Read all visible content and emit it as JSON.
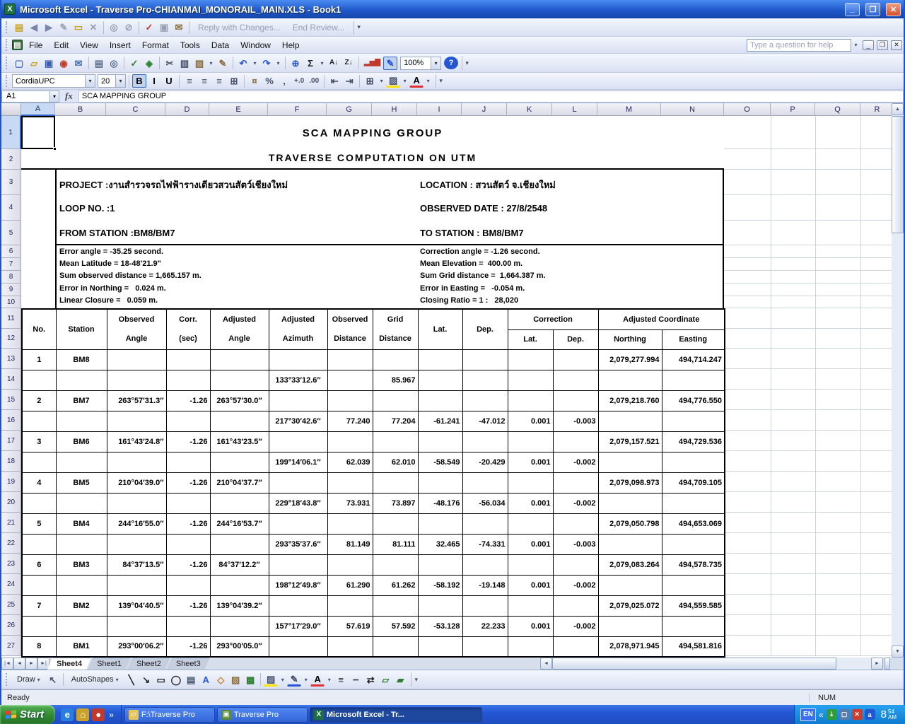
{
  "window": {
    "title": "Microsoft Excel - Traverse Pro-CHIANMAI_MONORAIL_MAIN.XLS - Book1"
  },
  "review_toolbar": {
    "items": [
      {
        "name": "new-comment",
        "g": "▤",
        "c": "#c9a227"
      },
      {
        "name": "previous-comment",
        "g": "◀",
        "c": "#7a86a8"
      },
      {
        "name": "next-comment",
        "g": "▶",
        "c": "#7a86a8"
      },
      {
        "name": "edit-comment",
        "g": "✎",
        "c": "#9aa0b5"
      },
      {
        "name": "show-comments",
        "g": "▭",
        "c": "#c9a227"
      },
      {
        "name": "delete-comment",
        "g": "✕",
        "c": "#9aa0b5",
        "sepAfter": true
      },
      {
        "name": "accept-change",
        "g": "◎",
        "c": "#9aa0b5"
      },
      {
        "name": "reject-change",
        "g": "⊘",
        "c": "#9aa0b5",
        "sepAfter": true
      },
      {
        "name": "update-file",
        "g": "✓",
        "c": "#c03a2b"
      },
      {
        "name": "save-version",
        "g": "▣",
        "c": "#9aa0b5"
      },
      {
        "name": "mail-recipient",
        "g": "✉",
        "c": "#8a6d3b",
        "sepAfter": true
      }
    ],
    "reply_label": "Reply with Changes...",
    "end_label": "End Review..."
  },
  "menus": [
    "File",
    "Edit",
    "View",
    "Insert",
    "Format",
    "Tools",
    "Data",
    "Window",
    "Help"
  ],
  "help_box_placeholder": "Type a question for help",
  "standard_toolbar": {
    "items": [
      {
        "name": "new-workbook",
        "g": "▢",
        "c": "#4a6fb5"
      },
      {
        "name": "open",
        "g": "▱",
        "c": "#c9a227"
      },
      {
        "name": "save",
        "g": "▣",
        "c": "#3a5fae"
      },
      {
        "name": "permission",
        "g": "◉",
        "c": "#c03a2b"
      },
      {
        "name": "email",
        "g": "✉",
        "c": "#4a6fb5",
        "sepAfter": true
      },
      {
        "name": "print",
        "g": "▤",
        "c": "#5a6e8c"
      },
      {
        "name": "print-preview",
        "g": "◎",
        "c": "#5a6e8c",
        "sepAfter": true
      },
      {
        "name": "spelling",
        "g": "✓",
        "c": "#2e7d32"
      },
      {
        "name": "research",
        "g": "◈",
        "c": "#2e7d32",
        "sepAfter": true
      },
      {
        "name": "cut",
        "g": "✂",
        "c": "#44506b"
      },
      {
        "name": "copy",
        "g": "▥",
        "c": "#44506b"
      },
      {
        "name": "paste",
        "g": "▧",
        "c": "#8a6d3b",
        "dd": true
      },
      {
        "name": "format-painter",
        "g": "✎",
        "c": "#8a6d3b",
        "sepAfter": true
      },
      {
        "name": "undo",
        "g": "↶",
        "c": "#2456d4",
        "dd": true
      },
      {
        "name": "redo",
        "g": "↷",
        "c": "#2456d4",
        "dd": true,
        "sepAfter": true
      },
      {
        "name": "insert-hyperlink",
        "g": "⊕",
        "c": "#2456d4"
      },
      {
        "name": "autosum",
        "g": "Σ",
        "c": "#222222",
        "dd": true
      },
      {
        "name": "sort-ascending",
        "g": "A↓",
        "c": "#222222",
        "small": true
      },
      {
        "name": "sort-descending",
        "g": "Z↓",
        "c": "#222222",
        "small": true,
        "sepAfter": true
      },
      {
        "name": "chart-wizard",
        "g": "▂▅▇",
        "c": "#c03a2b",
        "small": true
      },
      {
        "name": "drawing",
        "g": "✎",
        "c": "#2456d4",
        "active": true
      }
    ],
    "zoom_value": "100%",
    "help_glyph": "?"
  },
  "formatting_toolbar": {
    "font_name": "CordiaUPC",
    "font_size": "20",
    "items": [
      {
        "name": "bold",
        "g": "B",
        "c": "#000000",
        "active": true
      },
      {
        "name": "italic",
        "g": "I",
        "c": "#000000"
      },
      {
        "name": "underline",
        "g": "U",
        "c": "#000000",
        "sepAfter": true
      },
      {
        "name": "align-left",
        "g": "≡",
        "c": "#44506b"
      },
      {
        "name": "align-center",
        "g": "≡",
        "c": "#44506b"
      },
      {
        "name": "align-right",
        "g": "≡",
        "c": "#44506b"
      },
      {
        "name": "merge-center",
        "g": "⊞",
        "c": "#44506b",
        "sepAfter": true
      },
      {
        "name": "currency",
        "g": "¤",
        "c": "#8a6d3b"
      },
      {
        "name": "percent",
        "g": "%",
        "c": "#44506b"
      },
      {
        "name": "comma",
        "g": ",",
        "c": "#44506b"
      },
      {
        "name": "increase-decimal",
        "g": "+.0",
        "c": "#44506b",
        "small": true
      },
      {
        "name": "decrease-decimal",
        "g": ".00",
        "c": "#44506b",
        "small": true,
        "sepAfter": true
      },
      {
        "name": "decrease-indent",
        "g": "⇤",
        "c": "#44506b"
      },
      {
        "name": "increase-indent",
        "g": "⇥",
        "c": "#44506b",
        "sepAfter": true
      },
      {
        "name": "borders",
        "g": "⊞",
        "c": "#44506b",
        "dd": true
      },
      {
        "name": "fill-color",
        "g": "▨",
        "c": "#44506b",
        "u": "#ffe400",
        "dd": true
      },
      {
        "name": "font-color",
        "g": "A",
        "c": "#000000",
        "u": "#e03030",
        "dd": true
      }
    ]
  },
  "formula_bar": {
    "name_box": "A1",
    "fx": "fx",
    "formula": "SCA MAPPING GROUP"
  },
  "sheet": {
    "columns": [
      "A",
      "B",
      "C",
      "D",
      "E",
      "F",
      "G",
      "H",
      "I",
      "J",
      "K",
      "L",
      "M",
      "N",
      "O",
      "P",
      "Q",
      "R"
    ],
    "rows": [
      "1",
      "2",
      "3",
      "4",
      "5",
      "6",
      "7",
      "8",
      "9",
      "10",
      "11",
      "12",
      "13",
      "14",
      "15",
      "16",
      "17",
      "18",
      "19",
      "20",
      "21",
      "22",
      "23",
      "24",
      "25",
      "26",
      "27"
    ],
    "titles": [
      "SCA MAPPING GROUP",
      "TRAVERSE COMPUTATION ON UTM"
    ],
    "info": {
      "left": [
        "PROJECT :งานสำรวจรถไฟฟ้ารางเดียวสวนสัตว์เชียงใหม่",
        "LOOP NO. :1",
        "FROM STATION :BM8/BM7"
      ],
      "right": [
        "LOCATION : สวนสัตว์ จ.เชียงใหม่",
        "OBSERVED DATE : 27/8/2548",
        "TO STATION : BM8/BM7"
      ]
    },
    "stats": {
      "left": [
        "Error angle = -35.25 second.",
        "Mean Latitude = 18-48'21.9\"",
        "Sum observed distance = 1,665.157 m.",
        "Error in Northing =   0.024 m.",
        "Linear Closure =   0.059 m."
      ],
      "right": [
        "Correction angle = -1.26 second.",
        "Mean Elevation =  400.00 m.",
        "Sum Grid distance =  1,664.387 m.",
        "Error in Easting =   -0.054 m.",
        "Closing Ratio = 1 :   28,020"
      ]
    }
  },
  "grid": {
    "headers": {
      "no": "No.",
      "station": "Station",
      "observed": [
        "Observed",
        "Angle"
      ],
      "corr": [
        "Corr.",
        "(sec)"
      ],
      "adjusted": [
        "Adjusted",
        "Angle"
      ],
      "azimuth": [
        "Adjusted",
        "Azimuth"
      ],
      "obsdist": [
        "Observed",
        "Distance"
      ],
      "griddist": [
        "Grid",
        "Distance"
      ],
      "lat": "Lat.",
      "dep": "Dep.",
      "correction": "Correction",
      "corr_lat": "Lat.",
      "corr_dep": "Dep.",
      "adj_coord": "Adjusted Coordinate",
      "northing": "Northing",
      "easting": "Easting"
    },
    "rows": [
      {
        "no": "1",
        "st": "BM8",
        "n": "2,079,277.994",
        "e": "494,714.247"
      },
      {
        "az": "133°33′12.6″",
        "gd": "85.967"
      },
      {
        "no": "2",
        "st": "BM7",
        "oa": "263°57′31.3″",
        "c": "-1.26",
        "aa": "263°57′30.0″",
        "n": "2,079,218.760",
        "e": "494,776.550"
      },
      {
        "az": "217°30′42.6″",
        "od": "77.240",
        "gd": "77.204",
        "la": "-61.241",
        "de": "-47.012",
        "cl": "0.001",
        "cd": "-0.003"
      },
      {
        "no": "3",
        "st": "BM6",
        "oa": "161°43′24.8″",
        "c": "-1.26",
        "aa": "161°43′23.5″",
        "n": "2,079,157.521",
        "e": "494,729.536"
      },
      {
        "az": "199°14′06.1″",
        "od": "62.039",
        "gd": "62.010",
        "la": "-58.549",
        "de": "-20.429",
        "cl": "0.001",
        "cd": "-0.002"
      },
      {
        "no": "4",
        "st": "BM5",
        "oa": "210°04′39.0″",
        "c": "-1.26",
        "aa": "210°04′37.7″",
        "n": "2,079,098.973",
        "e": "494,709.105"
      },
      {
        "az": "229°18′43.8″",
        "od": "73.931",
        "gd": "73.897",
        "la": "-48.176",
        "de": "-56.034",
        "cl": "0.001",
        "cd": "-0.002"
      },
      {
        "no": "5",
        "st": "BM4",
        "oa": "244°16′55.0″",
        "c": "-1.26",
        "aa": "244°16′53.7″",
        "n": "2,079,050.798",
        "e": "494,653.069"
      },
      {
        "az": "293°35′37.6″",
        "od": "81.149",
        "gd": "81.111",
        "la": "32.465",
        "de": "-74.331",
        "cl": "0.001",
        "cd": "-0.003"
      },
      {
        "no": "6",
        "st": "BM3",
        "oa": "84°37′13.5″",
        "c": "-1.26",
        "aa": "84°37′12.2″",
        "n": "2,079,083.264",
        "e": "494,578.735"
      },
      {
        "az": "198°12′49.8″",
        "od": "61.290",
        "gd": "61.262",
        "la": "-58.192",
        "de": "-19.148",
        "cl": "0.001",
        "cd": "-0.002"
      },
      {
        "no": "7",
        "st": "BM2",
        "oa": "139°04′40.5″",
        "c": "-1.26",
        "aa": "139°04′39.2″",
        "n": "2,079,025.072",
        "e": "494,559.585"
      },
      {
        "az": "157°17′29.0″",
        "od": "57.619",
        "gd": "57.592",
        "la": "-53.128",
        "de": "22.233",
        "cl": "0.001",
        "cd": "-0.002"
      },
      {
        "no": "8",
        "st": "BM1",
        "oa": "293°00′06.2″",
        "c": "-1.26",
        "aa": "293°00′05.0″",
        "n": "2,078,971.945",
        "e": "494,581.816"
      }
    ]
  },
  "tabs": {
    "nav": [
      {
        "name": "first-sheet",
        "g": "|◄"
      },
      {
        "name": "previous-sheet",
        "g": "◄"
      },
      {
        "name": "next-sheet",
        "g": "►"
      },
      {
        "name": "last-sheet",
        "g": "►|"
      }
    ],
    "sheets": [
      {
        "label": "Sheet4",
        "active": true
      },
      {
        "label": "Sheet1"
      },
      {
        "label": "Sheet2"
      },
      {
        "label": "Sheet3"
      }
    ]
  },
  "drawing_toolbar": {
    "draw_label": "Draw",
    "autoshapes_label": "AutoShapes",
    "caret": "▾",
    "items": [
      {
        "name": "select-objects",
        "g": "↖",
        "c": "#44506b",
        "sepAfter": true
      },
      {
        "name": "line",
        "g": "╲",
        "c": "#222222"
      },
      {
        "name": "arrow",
        "g": "↘",
        "c": "#222222"
      },
      {
        "name": "rectangle",
        "g": "▭",
        "c": "#222222"
      },
      {
        "name": "oval",
        "g": "◯",
        "c": "#222222"
      },
      {
        "name": "text-box",
        "g": "▤",
        "c": "#44506b"
      },
      {
        "name": "wordart",
        "g": "A",
        "c": "#2456d4"
      },
      {
        "name": "insert-diagram",
        "g": "◇",
        "c": "#c9782a"
      },
      {
        "name": "clip-art",
        "g": "▨",
        "c": "#8a6d3b"
      },
      {
        "name": "insert-picture",
        "g": "▩",
        "c": "#2e7d32",
        "sepAfter": true
      },
      {
        "name": "fill-color",
        "g": "▨",
        "c": "#44506b",
        "u": "#ffe400",
        "dd": true
      },
      {
        "name": "line-color",
        "g": "✎",
        "c": "#44506b",
        "u": "#2456d4",
        "dd": true
      },
      {
        "name": "font-color",
        "g": "A",
        "c": "#000000",
        "u": "#e03030",
        "dd": true
      },
      {
        "name": "line-style",
        "g": "≡",
        "c": "#222222"
      },
      {
        "name": "dash-style",
        "g": "┄",
        "c": "#222222"
      },
      {
        "name": "arrow-style",
        "g": "⇄",
        "c": "#222222"
      },
      {
        "name": "shadow-style",
        "g": "▱",
        "c": "#2e7d32"
      },
      {
        "name": "3d-style",
        "g": "▰",
        "c": "#2e7d32"
      }
    ]
  },
  "status": {
    "ready": "Ready",
    "num": "NUM"
  },
  "taskbar": {
    "start_label": "Start",
    "quick_launch": [
      {
        "name": "internet-explorer",
        "g": "e",
        "bg": "#2a7de0"
      },
      {
        "name": "show-desktop",
        "g": "⌂",
        "bg": "#c9a227"
      },
      {
        "name": "media-player",
        "g": "●",
        "bg": "#c0392b"
      }
    ],
    "overflow": "»",
    "tasks": [
      {
        "label": "F:\\Traverse Pro",
        "icon": "folder-icon",
        "g": "▱",
        "bg": "#e8c55a"
      },
      {
        "label": "Traverse Pro",
        "icon": "app-icon",
        "g": "▣",
        "bg": "#5a8a3c"
      },
      {
        "label": "Microsoft Excel - Tr...",
        "icon": "excel-icon",
        "g": "X",
        "bg": "#1d7044",
        "active": true
      }
    ],
    "tray": {
      "language": "EN",
      "chevron": "«",
      "icons": [
        {
          "name": "update-ready",
          "g": "⇣",
          "bg": "#2e9e3a"
        },
        {
          "name": "network",
          "g": "▢",
          "bg": "#5a7aa8"
        },
        {
          "name": "security-alert",
          "g": "✕",
          "bg": "#d23a2a"
        },
        {
          "name": "antivirus",
          "g": "a",
          "bg": "#2456d4"
        }
      ],
      "clock_hour": "8",
      "clock_min": "54",
      "clock_ampm": "AM"
    }
  }
}
